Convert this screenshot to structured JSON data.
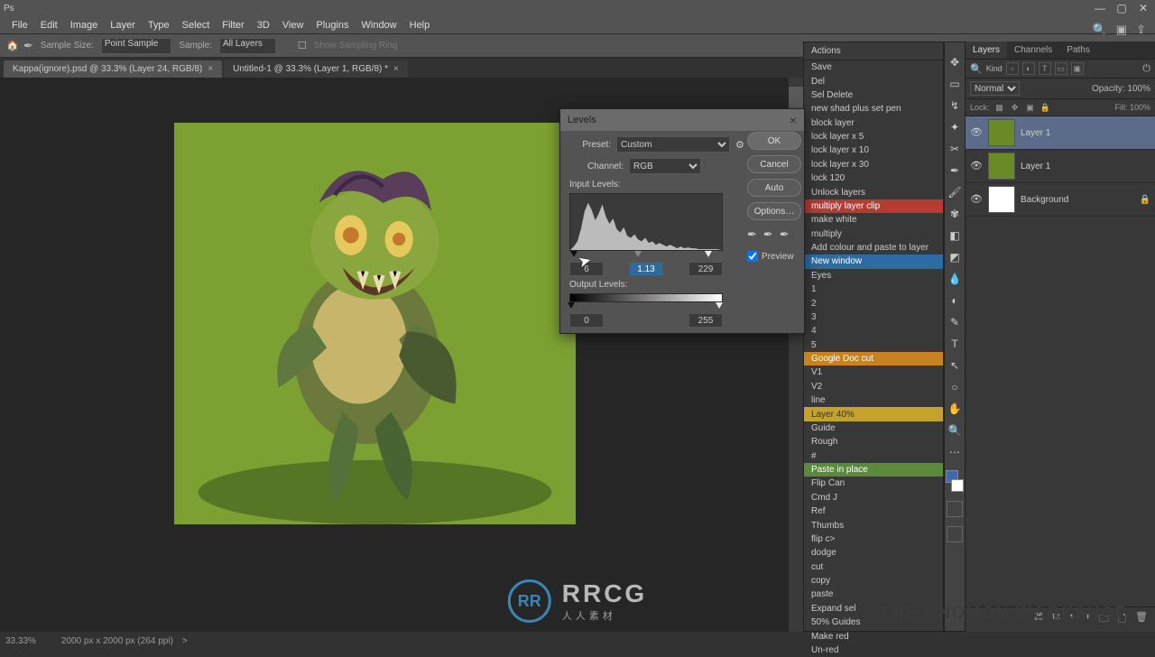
{
  "app": {
    "title": "Ps"
  },
  "menu": [
    "File",
    "Edit",
    "Image",
    "Layer",
    "Type",
    "Select",
    "Filter",
    "3D",
    "View",
    "Plugins",
    "Window",
    "Help"
  ],
  "options": {
    "sampleSizeLabel": "Sample Size:",
    "sampleSize": "Point Sample",
    "sampleLabel": "Sample:",
    "sample": "All Layers",
    "showRing": "Show Sampling Ring"
  },
  "tabs": [
    {
      "label": "Kappa(ignore).psd @ 33.3% (Layer 24, RGB/8)",
      "x": "×"
    },
    {
      "label": "Untitled-1 @ 33.3% (Layer 1, RGB/8) *",
      "x": "×"
    }
  ],
  "status": {
    "zoom": "33.33%",
    "doc": "2000 px x 2000 px (264 ppi)",
    "arrow": ">"
  },
  "actions": {
    "title": "Actions",
    "items": [
      {
        "label": "Save"
      },
      {
        "label": "Del"
      },
      {
        "label": "Sel Delete"
      },
      {
        "label": "new shad plus set pen"
      },
      {
        "label": "block layer"
      },
      {
        "label": "lock layer x 5"
      },
      {
        "label": "lock layer x 10"
      },
      {
        "label": "lock layer x 30"
      },
      {
        "label": "lock 120"
      },
      {
        "label": "Unlock layers"
      },
      {
        "label": "multiply layer clip",
        "hl": "red"
      },
      {
        "label": "make white"
      },
      {
        "label": "multiply"
      },
      {
        "label": "Add colour and paste to layer"
      },
      {
        "label": "New window",
        "hl": "blue"
      },
      {
        "label": "Eyes"
      },
      {
        "label": "1"
      },
      {
        "label": "2"
      },
      {
        "label": "3"
      },
      {
        "label": "4"
      },
      {
        "label": "5"
      },
      {
        "label": "Google Doc cut",
        "hl": "orange"
      },
      {
        "label": "V1"
      },
      {
        "label": "V2"
      },
      {
        "label": "line"
      },
      {
        "label": "Layer 40%",
        "hl": "yellow"
      },
      {
        "label": "Guide"
      },
      {
        "label": "Rough"
      },
      {
        "label": "#"
      },
      {
        "label": "Paste in place",
        "hl": "green"
      },
      {
        "label": "Flip Can"
      },
      {
        "label": "Cmd J"
      },
      {
        "label": "Ref"
      },
      {
        "label": "Thumbs"
      },
      {
        "label": "flip c>"
      },
      {
        "label": "dodge"
      },
      {
        "label": "cut"
      },
      {
        "label": "copy"
      },
      {
        "label": "paste"
      },
      {
        "label": "Expand sel"
      },
      {
        "label": "50% Guides"
      },
      {
        "label": "Make red"
      },
      {
        "label": "Un-red"
      }
    ]
  },
  "layers": {
    "tabs": [
      "Layers",
      "Channels",
      "Paths"
    ],
    "kindLabel": "Kind",
    "blend": "Normal",
    "opacityLabel": "Opacity:",
    "opacity": "100%",
    "lockLabel": "Lock:",
    "fillLabel": "Fill:",
    "fill": "100%",
    "items": [
      {
        "name": "Layer 1",
        "sel": true
      },
      {
        "name": "Layer 1"
      },
      {
        "name": "Background",
        "locked": true,
        "white": true
      }
    ]
  },
  "levels": {
    "title": "Levels",
    "presetLabel": "Preset:",
    "preset": "Custom",
    "channelLabel": "Channel:",
    "channel": "RGB",
    "inputLabel": "Input Levels:",
    "outputLabel": "Output Levels:",
    "inBlack": "6",
    "inMid": "1.13",
    "inWhite": "229",
    "outBlack": "0",
    "outWhite": "255",
    "ok": "OK",
    "cancel": "Cancel",
    "auto": "Auto",
    "options": "Options…",
    "preview": "Preview",
    "close": "×"
  },
  "watermark": {
    "logo": "RR",
    "big": "RRCG",
    "small": "人人素材"
  },
  "gnomon": "THE GNOMON WORKSHOP"
}
